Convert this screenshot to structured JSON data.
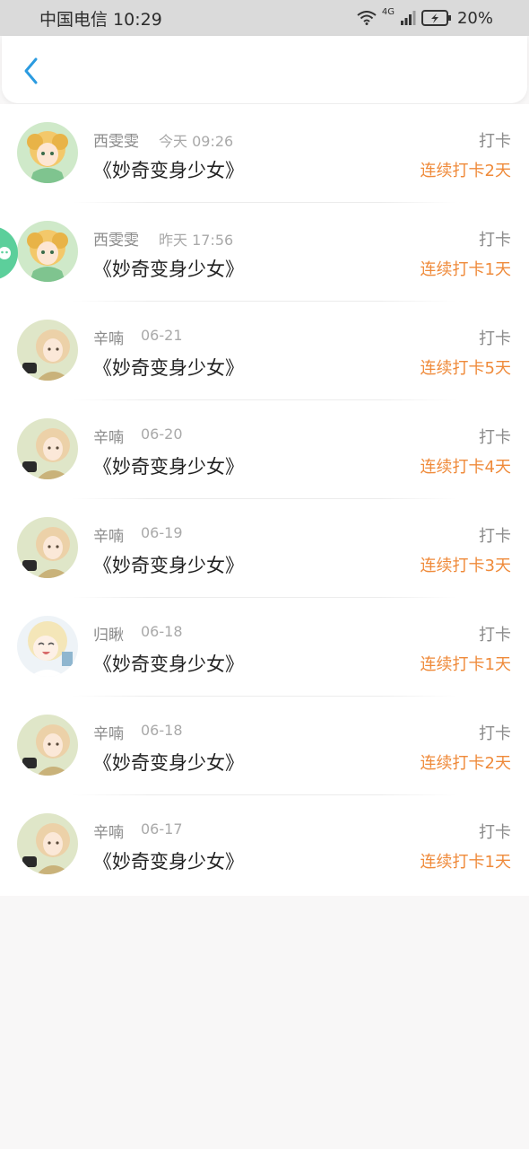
{
  "status_bar": {
    "carrier_time": "中国电信 10:29",
    "network": "4G",
    "battery": "20%"
  },
  "header": {
    "back_icon": "chevron-left-icon"
  },
  "colors": {
    "accent_back": "#2b9be0",
    "streak": "#ef8a3a",
    "float_widget": "#5ccf9b"
  },
  "list": {
    "items": [
      {
        "name": "西雯雯",
        "time": "今天 09:26",
        "title": "《妙奇变身少女》",
        "tag": "打卡",
        "streak": "连续打卡2天",
        "avatar": "avatar-green-girl"
      },
      {
        "name": "西雯雯",
        "time": "昨天 17:56",
        "title": "《妙奇变身少女》",
        "tag": "打卡",
        "streak": "连续打卡1天",
        "avatar": "avatar-green-girl"
      },
      {
        "name": "辛喃",
        "time": "06-21",
        "title": "《妙奇变身少女》",
        "tag": "打卡",
        "streak": "连续打卡5天",
        "avatar": "avatar-blonde-camera"
      },
      {
        "name": "辛喃",
        "time": "06-20",
        "title": "《妙奇变身少女》",
        "tag": "打卡",
        "streak": "连续打卡4天",
        "avatar": "avatar-blonde-camera"
      },
      {
        "name": "辛喃",
        "time": "06-19",
        "title": "《妙奇变身少女》",
        "tag": "打卡",
        "streak": "连续打卡3天",
        "avatar": "avatar-blonde-camera"
      },
      {
        "name": "归瞅",
        "time": "06-18",
        "title": "《妙奇变身少女》",
        "tag": "打卡",
        "streak": "连续打卡1天",
        "avatar": "avatar-laughing-girl"
      },
      {
        "name": "辛喃",
        "time": "06-18",
        "title": "《妙奇变身少女》",
        "tag": "打卡",
        "streak": "连续打卡2天",
        "avatar": "avatar-blonde-camera"
      },
      {
        "name": "辛喃",
        "time": "06-17",
        "title": "《妙奇变身少女》",
        "tag": "打卡",
        "streak": "连续打卡1天",
        "avatar": "avatar-blonde-camera"
      }
    ]
  }
}
